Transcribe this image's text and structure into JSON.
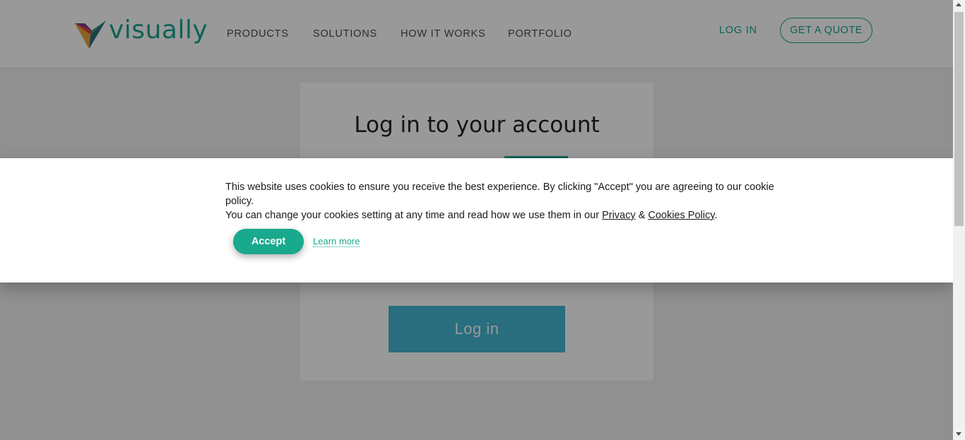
{
  "header": {
    "logo_text": "visually",
    "nav": [
      "PRODUCTS",
      "SOLUTIONS",
      "HOW IT WORKS",
      "PORTFOLIO"
    ],
    "login_label": "LOG IN",
    "quote_label": "GET A QUOTE"
  },
  "login_card": {
    "title": "Log in to your account",
    "button_label": "Log in"
  },
  "cookie_banner": {
    "line1": "This website uses cookies to ensure you receive the best experience. By clicking \"Accept\" you are agreeing to our cookie policy.",
    "line2_prefix": "You can change your cookies setting at any time and read how we use them in our ",
    "privacy_link": "Privacy",
    "ampersand": " & ",
    "cookies_link": "Cookies Policy",
    "line2_suffix": ".",
    "accept_label": "Accept",
    "learn_more_label": "Learn more"
  },
  "colors": {
    "accent": "#1aa391",
    "login_button": "#43b8d3",
    "accept_button": "#19a98c"
  },
  "icons": [
    "visually-logo-icon",
    "scroll-up-arrow-icon",
    "scroll-down-arrow-icon"
  ]
}
